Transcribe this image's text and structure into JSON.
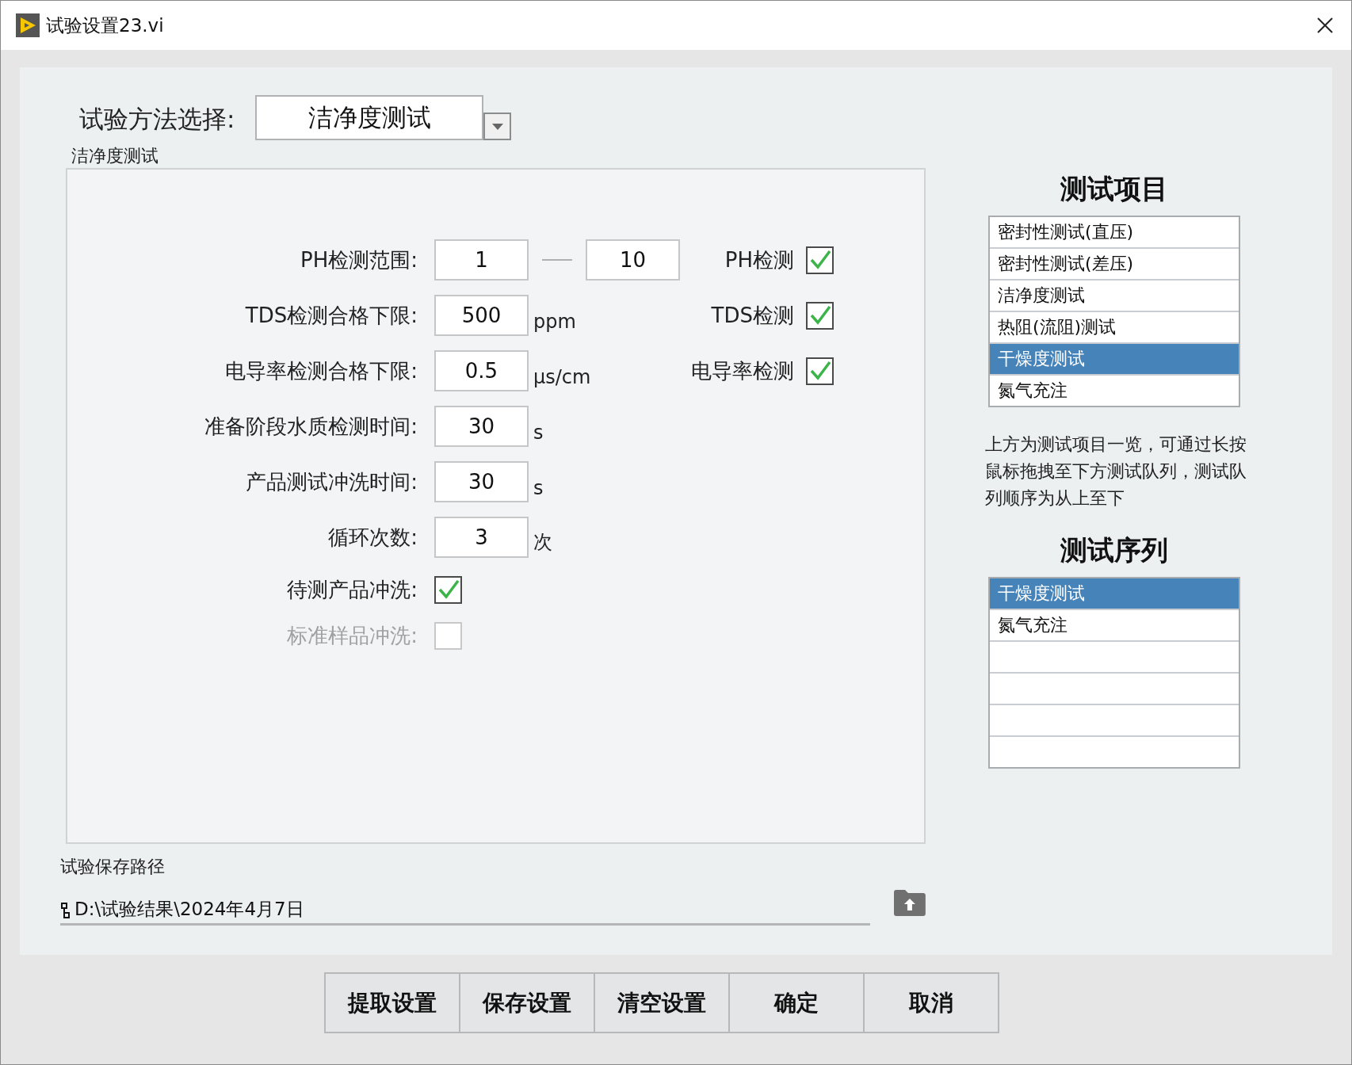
{
  "window": {
    "title": "试验设置23.vi"
  },
  "method": {
    "label": "试验方法选择:",
    "value": "洁净度测试"
  },
  "group": {
    "title": "洁净度测试",
    "rows": [
      {
        "kind": "range",
        "label": "PH检测范围:",
        "min": "1",
        "max": "10",
        "check": {
          "label": "PH检测",
          "checked": true
        }
      },
      {
        "kind": "number",
        "label": "TDS检测合格下限:",
        "value": "500",
        "unit": "ppm",
        "check": {
          "label": "TDS检测",
          "checked": true
        }
      },
      {
        "kind": "number",
        "label": "电导率检测合格下限:",
        "value": "0.5",
        "unit": "μs/cm",
        "check": {
          "label": "电导率检测",
          "checked": true
        }
      },
      {
        "kind": "number",
        "label": "准备阶段水质检测时间:",
        "value": "30",
        "unit": "s"
      },
      {
        "kind": "number",
        "label": "产品测试冲洗时间:",
        "value": "30",
        "unit": "s"
      },
      {
        "kind": "number",
        "label": "循环次数:",
        "value": "3",
        "unit": "次"
      },
      {
        "kind": "checkbox",
        "label": "待测产品冲洗:",
        "checked": true,
        "disabled": false
      },
      {
        "kind": "checkbox",
        "label": "标准样品冲洗:",
        "checked": false,
        "disabled": true
      }
    ]
  },
  "save_path": {
    "label": "试验保存路径",
    "value": "D:\\试验结果\\2024年4月7日"
  },
  "test_items": {
    "title": "测试项目",
    "items": [
      {
        "label": "密封性测试(直压)",
        "selected": false
      },
      {
        "label": "密封性测试(差压)",
        "selected": false
      },
      {
        "label": "洁净度测试",
        "selected": false
      },
      {
        "label": "热阻(流阻)测试",
        "selected": false
      },
      {
        "label": "干燥度测试",
        "selected": true
      },
      {
        "label": "氮气充注",
        "selected": false
      }
    ]
  },
  "hint": "上方为测试项目一览，可通过长按鼠标拖拽至下方测试队列，测试队列顺序为从上至下",
  "test_queue": {
    "title": "测试序列",
    "items": [
      {
        "label": "干燥度测试",
        "selected": true
      },
      {
        "label": "氮气充注",
        "selected": false
      }
    ]
  },
  "buttons": [
    "提取设置",
    "保存设置",
    "清空设置",
    "确定",
    "取消"
  ]
}
